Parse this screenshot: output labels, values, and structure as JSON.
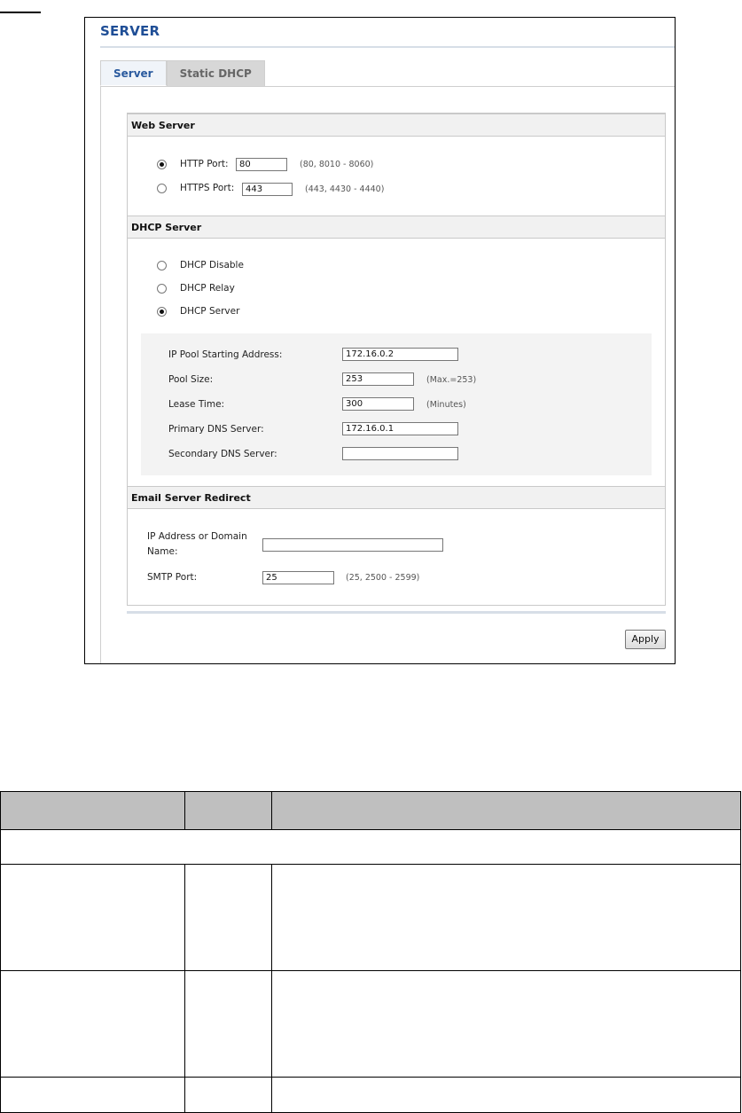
{
  "page_title": "SERVER",
  "tabs": [
    {
      "label": "Server",
      "active": true
    },
    {
      "label": "Static DHCP",
      "active": false
    }
  ],
  "web_server": {
    "header": "Web Server",
    "http": {
      "label": "HTTP Port:",
      "value": "80",
      "hint": "(80, 8010 - 8060)",
      "selected": true
    },
    "https": {
      "label": "HTTPS Port:",
      "value": "443",
      "hint": "(443, 4430 - 4440)",
      "selected": false
    }
  },
  "dhcp_server": {
    "header": "DHCP Server",
    "options": [
      {
        "label": "DHCP Disable",
        "selected": false
      },
      {
        "label": "DHCP Relay",
        "selected": false
      },
      {
        "label": "DHCP Server",
        "selected": true
      }
    ],
    "fields": {
      "ip_pool_start": {
        "label": "IP Pool Starting Address:",
        "value": "172.16.0.2"
      },
      "pool_size": {
        "label": "Pool Size:",
        "value": "253",
        "hint": "(Max.=253)"
      },
      "lease_time": {
        "label": "Lease Time:",
        "value": "300",
        "hint": "(Minutes)"
      },
      "primary_dns": {
        "label": "Primary DNS Server:",
        "value": "172.16.0.1"
      },
      "secondary_dns": {
        "label": "Secondary DNS Server:",
        "value": ""
      }
    }
  },
  "email_redirect": {
    "header": "Email Server Redirect",
    "ip_domain": {
      "label_line1": "IP Address or Domain",
      "label_line2": "Name:",
      "value": ""
    },
    "smtp_port": {
      "label": "SMTP Port:",
      "value": "25",
      "hint": "(25, 2500 - 2599)"
    }
  },
  "apply_label": "Apply",
  "colors": {
    "title_blue": "#1f4e96",
    "header_gray": "#bfbfbf"
  }
}
